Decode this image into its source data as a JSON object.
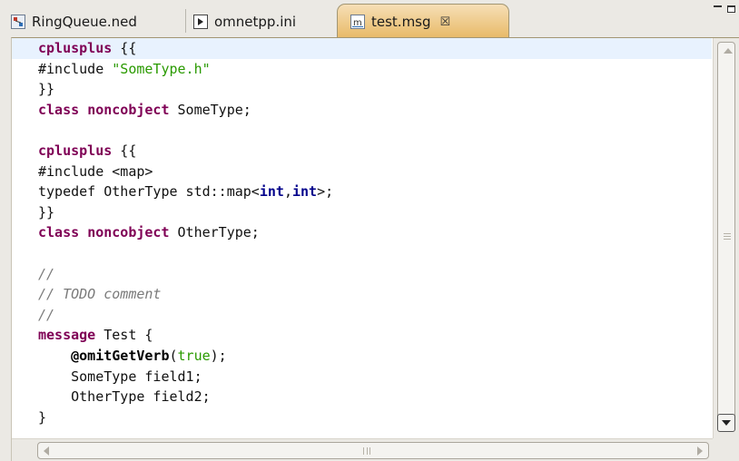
{
  "tabs": [
    {
      "label": "RingQueue.ned",
      "icon": "ned-file-icon",
      "active": false
    },
    {
      "label": "omnetpp.ini",
      "icon": "ini-file-icon",
      "active": false
    },
    {
      "label": "test.msg",
      "icon": "msg-file-icon",
      "active": true,
      "close": "☒"
    }
  ],
  "colors": {
    "keyword": "#7f0055",
    "string": "#2a9a00",
    "comment": "#7a7a7a",
    "active_tab": "#ecc47d",
    "current_line": "#e8f2fe"
  },
  "code": {
    "line1": {
      "kw": "cplusplus",
      "rest": " {{"
    },
    "line2": {
      "plain": "#include ",
      "str": "\"SomeType.h\""
    },
    "line3": {
      "plain": "}}"
    },
    "line4": {
      "kw1": "class",
      "kw2": "noncobject",
      "rest": " SomeType;"
    },
    "line5": {
      "plain": ""
    },
    "line6": {
      "kw": "cplusplus",
      "rest": " {{"
    },
    "line7": {
      "plain": "#include <map>"
    },
    "line8": {
      "pre": "typedef OtherType std::map<",
      "t1": "int",
      "comma": ",",
      "t2": "int",
      "post": ">;"
    },
    "line9": {
      "plain": "}}"
    },
    "line10": {
      "kw1": "class",
      "kw2": "noncobject",
      "rest": " OtherType;"
    },
    "line11": {
      "plain": ""
    },
    "line12": {
      "cmt": "//"
    },
    "line13": {
      "cmt": "// TODO comment"
    },
    "line14": {
      "cmt": "//"
    },
    "line15": {
      "kw": "message",
      "rest": " Test {"
    },
    "line16": {
      "indent": "    ",
      "ann": "@omitGetVerb",
      "open": "(",
      "val": "true",
      "close": ");"
    },
    "line17": {
      "plain": "    SomeType field1;"
    },
    "line18": {
      "plain": "    OtherType field2;"
    },
    "line19": {
      "plain": "}"
    }
  }
}
